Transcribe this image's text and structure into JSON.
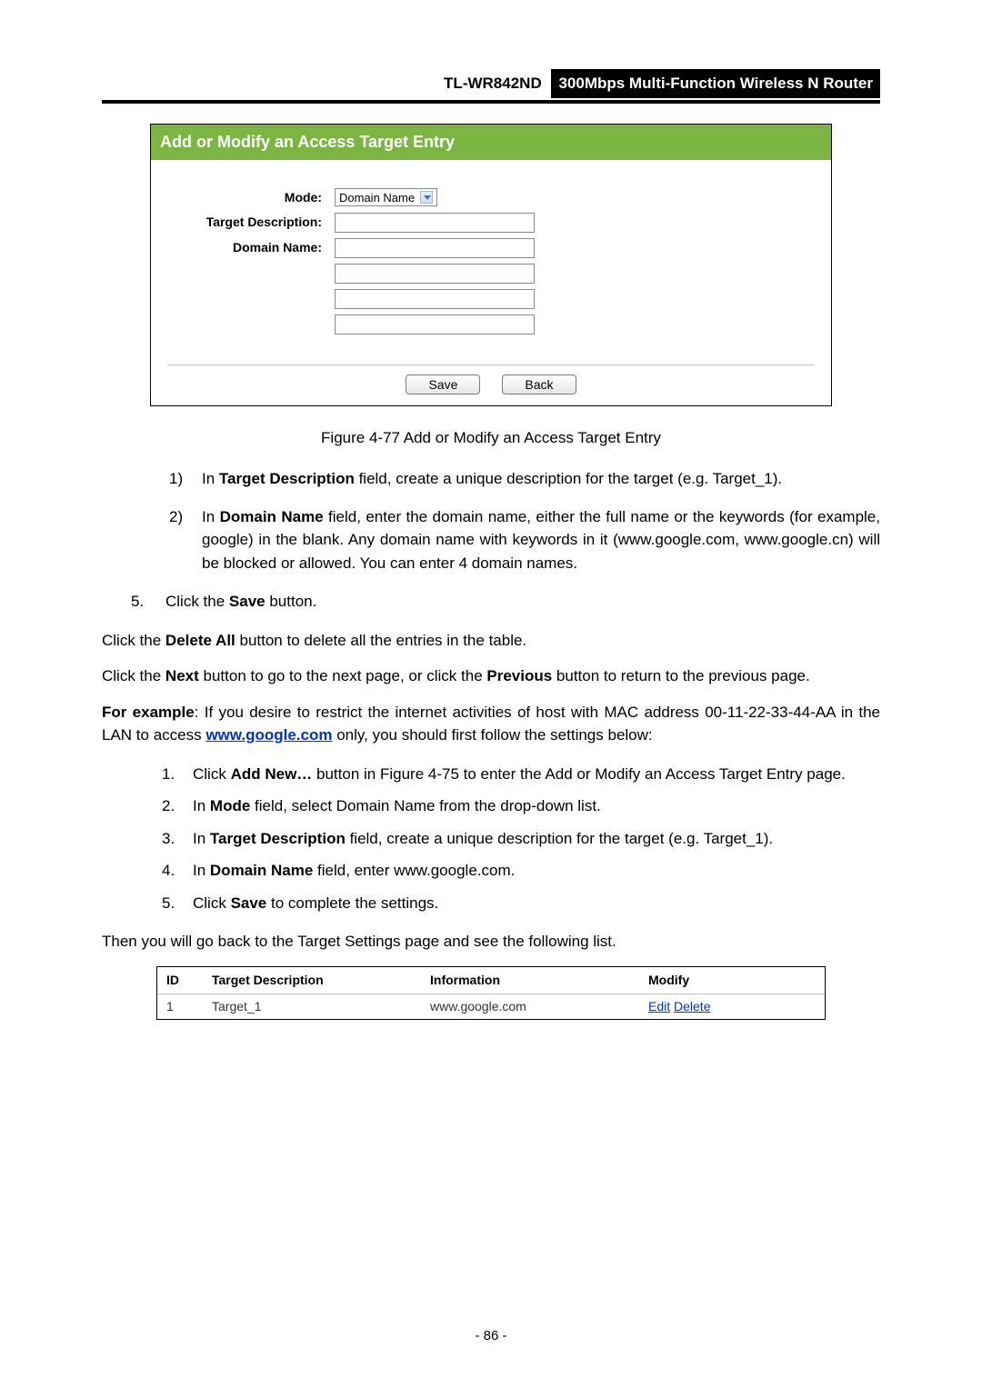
{
  "header": {
    "model": "TL-WR842ND",
    "title": "300Mbps Multi-Function Wireless N Router"
  },
  "panel": {
    "title": "Add or Modify an Access Target Entry",
    "labels": {
      "mode": "Mode:",
      "target_desc": "Target Description:",
      "domain_name": "Domain Name:"
    },
    "mode_value": "Domain Name",
    "buttons": {
      "save": "Save",
      "back": "Back"
    }
  },
  "caption": "Figure 4-77   Add or Modify an Access Target Entry",
  "step1": {
    "num": "1)",
    "pre": "In ",
    "field": "Target Description",
    "post": " field, create a unique description for the target (e.g. Target_1)."
  },
  "step2": {
    "num": "2)",
    "pre": "In ",
    "field": "Domain Name",
    "post": " field, enter the domain name, either the full name or the keywords (for example, google) in the blank. Any domain name with keywords in it (www.google.com, www.google.cn) will be blocked or allowed. You can enter 4 domain names."
  },
  "step5": {
    "num": "5.",
    "pre": "Click the ",
    "btn": "Save",
    "post": " button."
  },
  "p_delall": {
    "pre": "Click the ",
    "b": "Delete All",
    "post": " button to delete all the entries in the table."
  },
  "p_nav": {
    "pre": "Click the ",
    "b1": "Next",
    "mid": " button to go to the next page, or click the ",
    "b2": "Previous",
    "post": " button to return to the previous page."
  },
  "p_ex": {
    "lead": "For example",
    "pre": ": If you desire to restrict the internet activities of host with MAC address 00-11-22-33-44-AA in the LAN to access ",
    "link": "www.google.com",
    "post": " only, you should first follow the settings below:"
  },
  "ex_list": [
    {
      "num": "1.",
      "pre": "Click ",
      "b": "Add New…",
      "post": " button in Figure 4-75 to enter the Add or Modify an Access Target Entry page."
    },
    {
      "num": "2.",
      "pre": "In ",
      "b": "Mode",
      "post": " field, select Domain Name from the drop-down list."
    },
    {
      "num": "3.",
      "pre": "In ",
      "b": "Target Description",
      "post": " field, create a unique description for the target (e.g. Target_1)."
    },
    {
      "num": "4.",
      "pre": "In ",
      "b": "Domain Name",
      "post": " field, enter www.google.com."
    },
    {
      "num": "5.",
      "pre": "Click ",
      "b": "Save",
      "post": " to complete the settings."
    }
  ],
  "p_then": "Then you will go back to the Target Settings page and see the following list.",
  "tbl": {
    "headers": {
      "id": "ID",
      "td": "Target Description",
      "info": "Information",
      "mod": "Modify"
    },
    "row": {
      "id": "1",
      "td": "Target_1",
      "info": "www.google.com",
      "edit": "Edit",
      "del": "Delete"
    }
  },
  "page_num": "- 86 -"
}
